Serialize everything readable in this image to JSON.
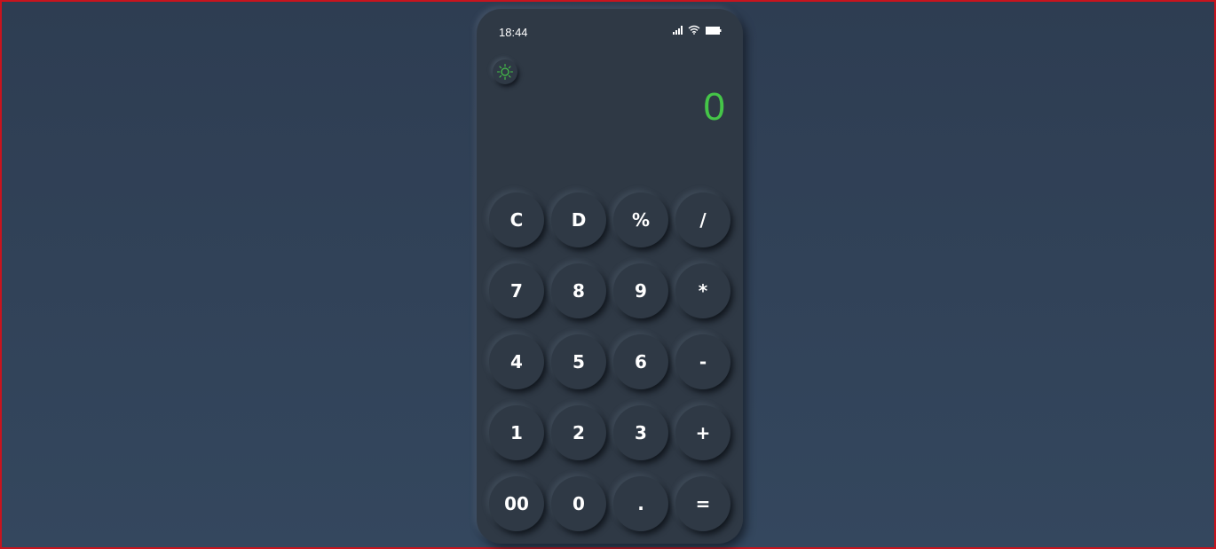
{
  "status": {
    "time": "18:44",
    "icons": [
      "signal-icon",
      "wifi-icon",
      "battery-icon"
    ]
  },
  "theme_toggle": {
    "icon": "sun-icon",
    "color": "#45c548"
  },
  "display": {
    "value": "0",
    "color": "#45c548"
  },
  "keys": [
    "C",
    "D",
    "%",
    "/",
    "7",
    "8",
    "9",
    "*",
    "4",
    "5",
    "6",
    "-",
    "1",
    "2",
    "3",
    "+",
    "00",
    "0",
    ".",
    "="
  ],
  "colors": {
    "page_background": "#31435a",
    "phone_background": "#2f3945",
    "key_text": "#ffffff",
    "accent": "#45c548",
    "frame_border": "#c8141e"
  }
}
